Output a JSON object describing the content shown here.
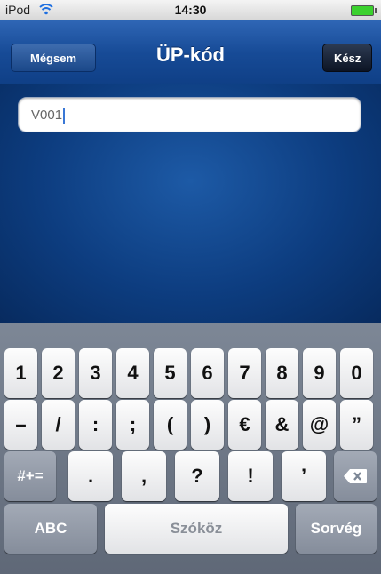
{
  "status": {
    "carrier": "iPod",
    "time": "14:30"
  },
  "navbar": {
    "cancel": "Mégsem",
    "title": "ÜP-kód",
    "done": "Kész"
  },
  "input": {
    "value": "V001"
  },
  "keyboard": {
    "row1": [
      "1",
      "2",
      "3",
      "4",
      "5",
      "6",
      "7",
      "8",
      "9",
      "0"
    ],
    "row2": [
      "–",
      "/",
      ":",
      ";",
      "(",
      ")",
      "€",
      "&",
      "@",
      "”"
    ],
    "row3": {
      "mode": "#+=",
      "keys": [
        ".",
        ",",
        "?",
        "!",
        "’"
      ]
    },
    "row4": {
      "abc": "ABC",
      "space": "Szóköz",
      "return": "Sorvég"
    }
  },
  "colors": {
    "nav_top": "#2f66b5",
    "background": "#0d3d80",
    "battery": "#3bd12e"
  }
}
